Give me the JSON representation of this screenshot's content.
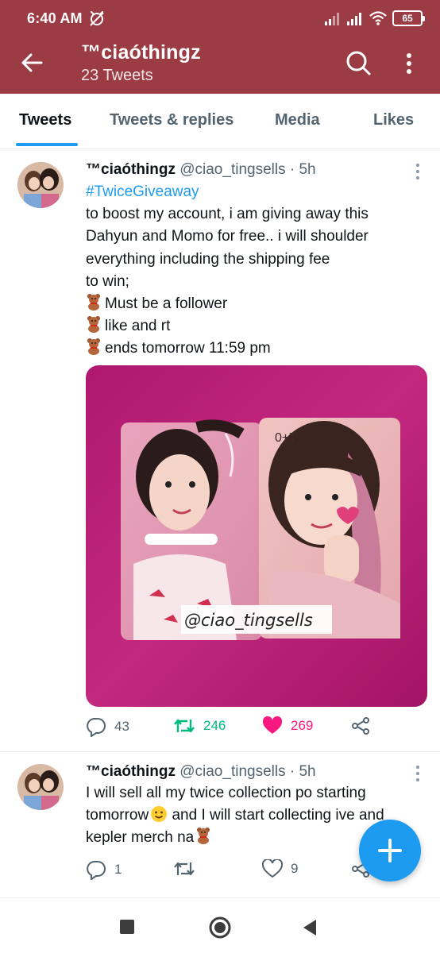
{
  "status_bar": {
    "time": "6:40 AM",
    "battery": "65"
  },
  "header": {
    "profile_name": "™ciaóthingz",
    "tweet_count": "23 Tweets"
  },
  "tabs": [
    {
      "label": "Tweets",
      "active": true
    },
    {
      "label": "Tweets & replies",
      "active": false
    },
    {
      "label": "Media",
      "active": false
    },
    {
      "label": "Likes",
      "active": false
    }
  ],
  "tweets": [
    {
      "name": "™ciaóthingz",
      "handle": "@ciao_tingsells · 5h",
      "hashtag": "#TwiceGiveaway",
      "lines": [
        "to boost my account, i am giving away this",
        "Dahyun and Momo for free.. i will shoulder",
        "everything including the shipping fee",
        "to win;"
      ],
      "bullets": [
        "Must be a follower",
        "like and rt",
        "ends tomorrow 11:59 pm"
      ],
      "photo_watermark": "@ciao_tingsells",
      "photo_card_mark": "0+T",
      "replies": "43",
      "retweets": "246",
      "likes": "269"
    },
    {
      "name": "™ciaóthingz",
      "handle": "@ciao_tingsells · 5h",
      "lines": [
        "I will sell all my twice collection po starting",
        "tomorrow",
        " and I will start collecting ive and",
        "kepler merch na"
      ],
      "replies": "1",
      "retweets": "",
      "likes": "9"
    }
  ],
  "icons": {
    "back": "arrow-left-icon",
    "search": "search-icon",
    "more": "more-vertical-icon",
    "reply": "reply-icon",
    "retweet": "retweet-icon",
    "like": "heart-icon",
    "share": "share-icon",
    "compose": "plus-icon",
    "bear": "teddy-bear-emoji",
    "smile": "slightly-smiling-face-emoji"
  },
  "colors": {
    "header_bg": "#9b3b44",
    "accent": "#1d9bf0",
    "retweet_active": "#00ba7c",
    "like_active": "#f91880"
  }
}
